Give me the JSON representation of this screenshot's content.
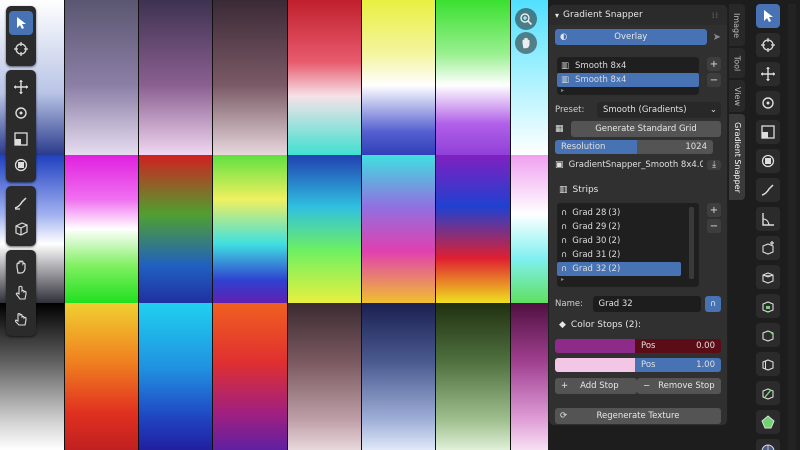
{
  "panel": {
    "title": "Gradient Snapper",
    "overlay_label": "Overlay",
    "palettes": [
      "Smooth 8x4",
      "Smooth 8x4"
    ],
    "preset_label": "Preset:",
    "preset_value": "Smooth (Gradients)",
    "generate_label": "Generate Standard Grid",
    "resolution_label": "Resolution",
    "resolution_value": "1024",
    "texture_name": "GradientSnapper_Smooth 8x4.0...",
    "strips_label": "Strips",
    "strips": [
      {
        "name": "Grad 28",
        "count": "(3)"
      },
      {
        "name": "Grad 29",
        "count": "(2)"
      },
      {
        "name": "Grad 30",
        "count": "(2)"
      },
      {
        "name": "Grad 31",
        "count": "(2)"
      },
      {
        "name": "Grad 32",
        "count": "(2)"
      }
    ],
    "name_label": "Name:",
    "name_value": "Grad 32",
    "color_stops_label": "Color Stops (2):",
    "stops": [
      {
        "pos_label": "Pos",
        "pos_value": "0.00",
        "color": "#8e2a8a"
      },
      {
        "pos_label": "Pos",
        "pos_value": "1.00",
        "color": "#f3c6e6"
      }
    ],
    "add_stop_label": "Add Stop",
    "remove_stop_label": "Remove Stop",
    "regenerate_label": "Regenerate Texture"
  },
  "tabs": [
    "Image",
    "Tool",
    "View",
    "Gradient Snapper"
  ],
  "colors": {
    "accent": "#4772b3",
    "panel_bg": "#303030",
    "field_bg": "#1d1d1d"
  }
}
